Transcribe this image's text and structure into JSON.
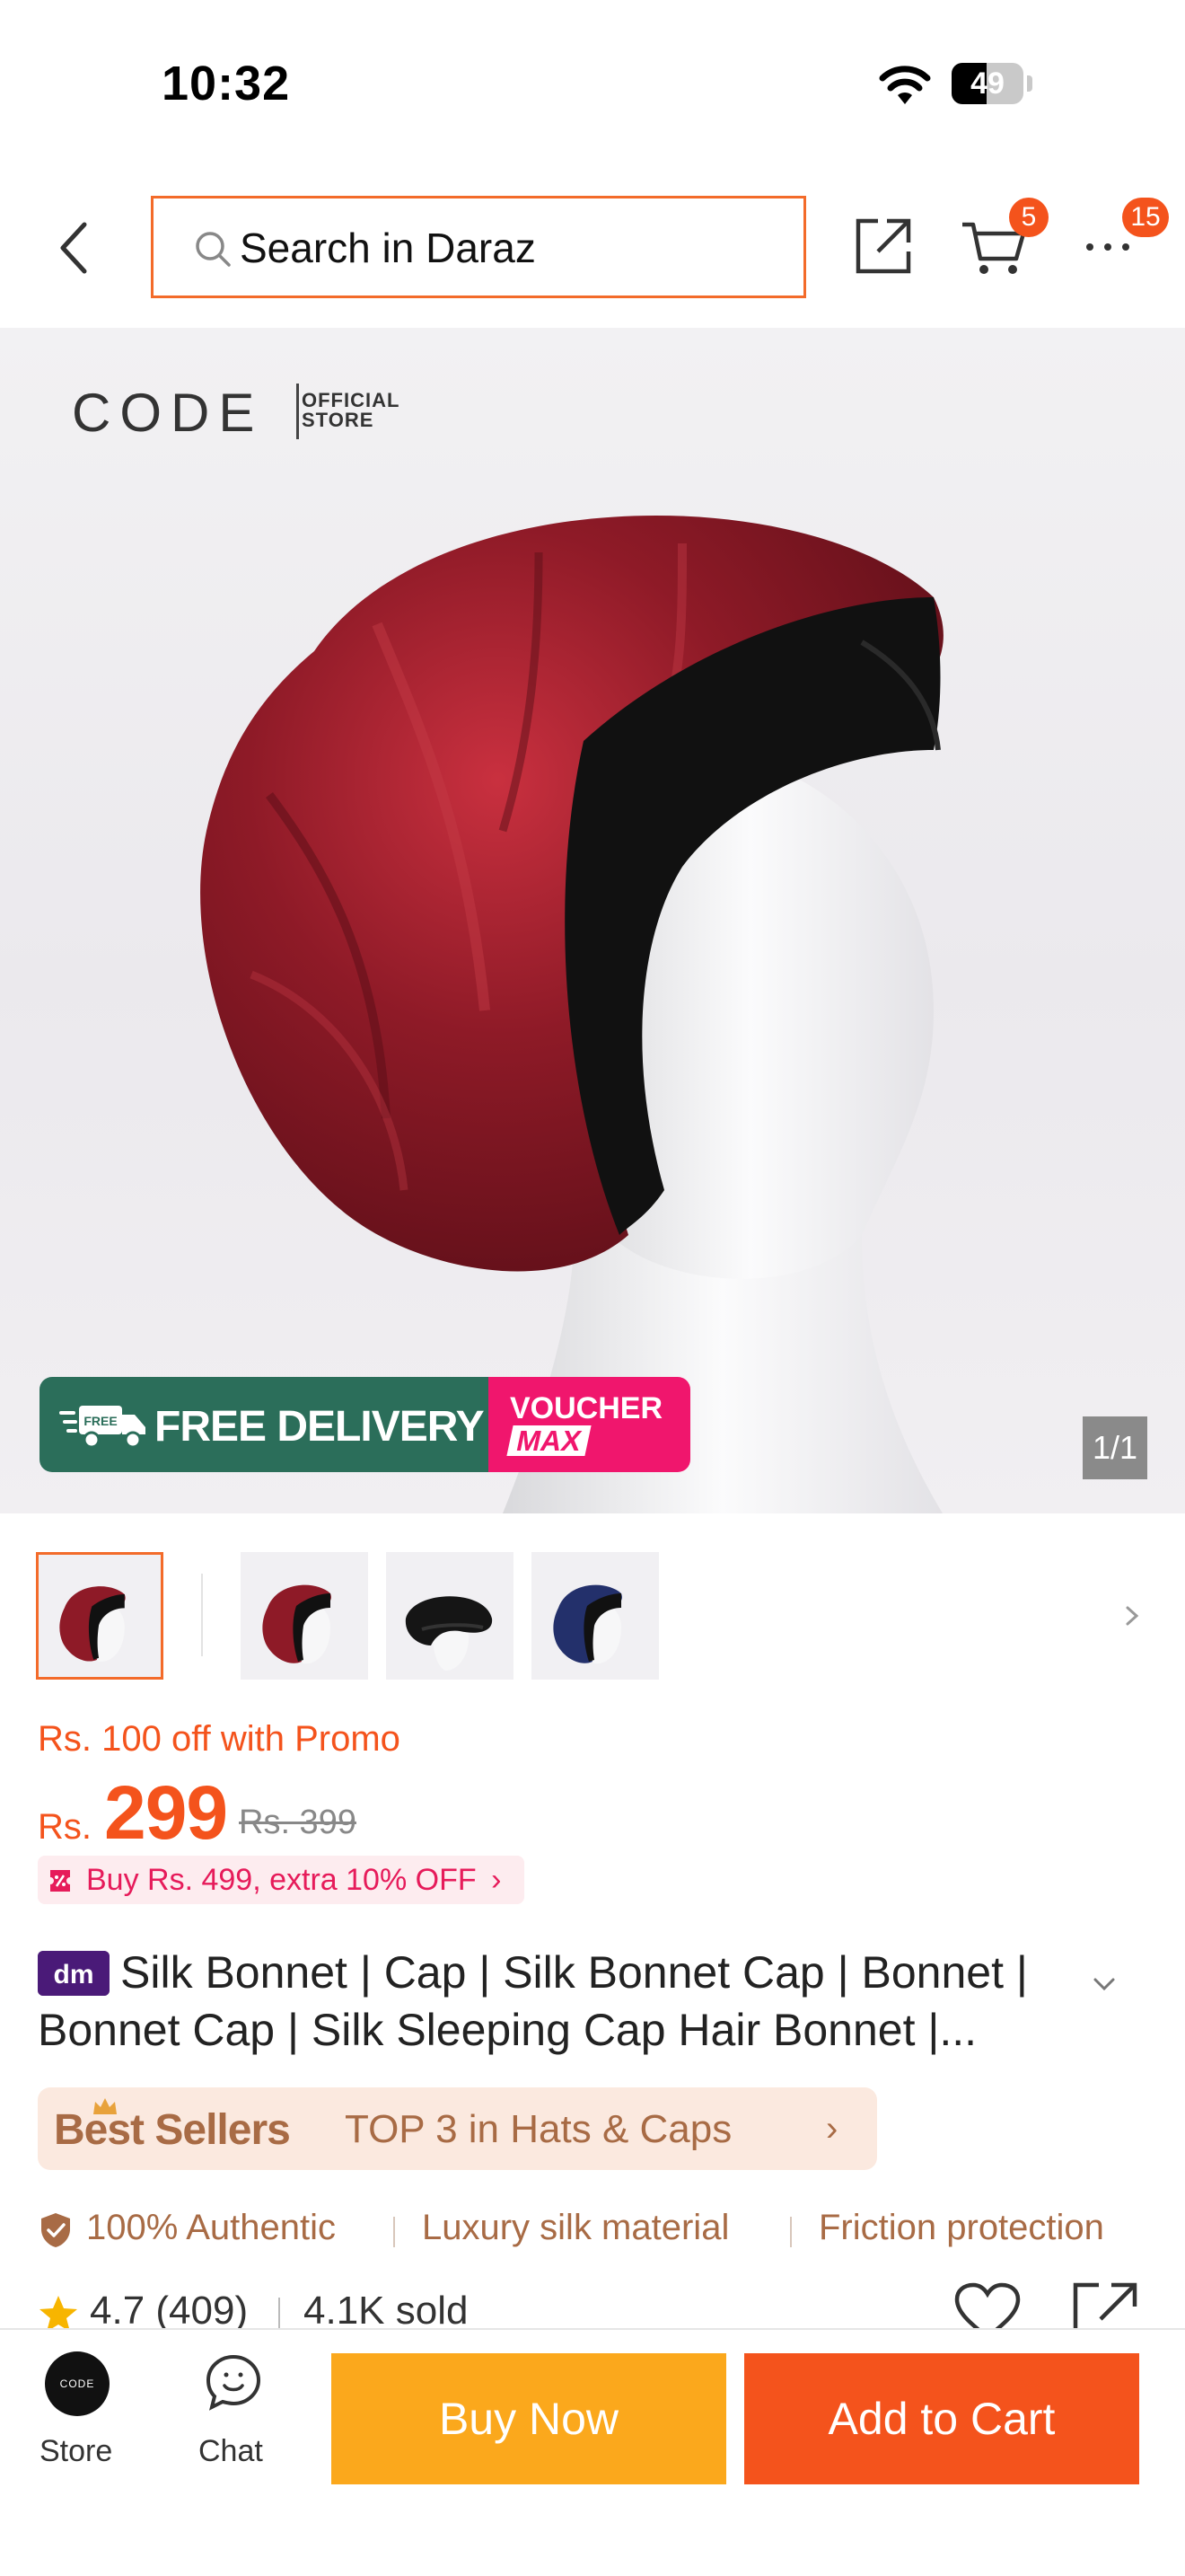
{
  "status_bar": {
    "time": "10:32",
    "battery": "49",
    "battery_level": 0.49
  },
  "header": {
    "search_placeholder": "Search in Daraz",
    "cart_count": "5",
    "more_count": "15"
  },
  "hero": {
    "brand": "CODE",
    "brand_sub_1": "OFFICIAL",
    "brand_sub_2": "STORE",
    "delivery_label": "FREE DELIVERY",
    "delivery_truck_label": "FREE",
    "voucher_label": "VOUCHER",
    "voucher_max": "MAX",
    "image_counter": "1/1"
  },
  "thumbnails": [
    {
      "color": "burgundy"
    },
    {
      "color": "burgundy"
    },
    {
      "color": "black"
    },
    {
      "color": "navy"
    }
  ],
  "price": {
    "promo": "Rs. 100 off with Promo",
    "currency": "Rs.",
    "current": "299",
    "original": "Rs. 399",
    "extra_offer": "Buy Rs. 499, extra 10% OFF"
  },
  "product": {
    "badge": "dm",
    "title": "Silk Bonnet | Cap | Silk Bonnet Cap | Bonnet | Bonnet Cap | Silk Sleeping Cap Hair Bonnet |..."
  },
  "best_seller": {
    "label": "Best Sellers",
    "rank": "TOP 3 in Hats & Caps"
  },
  "features": [
    "100% Authentic",
    "Luxury silk material",
    "Friction protection"
  ],
  "rating": {
    "score": "4.7 (409)",
    "sold": "4.1K sold"
  },
  "bottom_bar": {
    "store_label": "Store",
    "store_avatar_text": "CODE",
    "chat_label": "Chat",
    "buy_now": "Buy Now",
    "add_to_cart": "Add to Cart"
  },
  "colors": {
    "accent": "#f4531c",
    "buy_now": "#fba81c",
    "best_seller_text": "#a86b45",
    "extra_offer": "#e61b5a"
  }
}
